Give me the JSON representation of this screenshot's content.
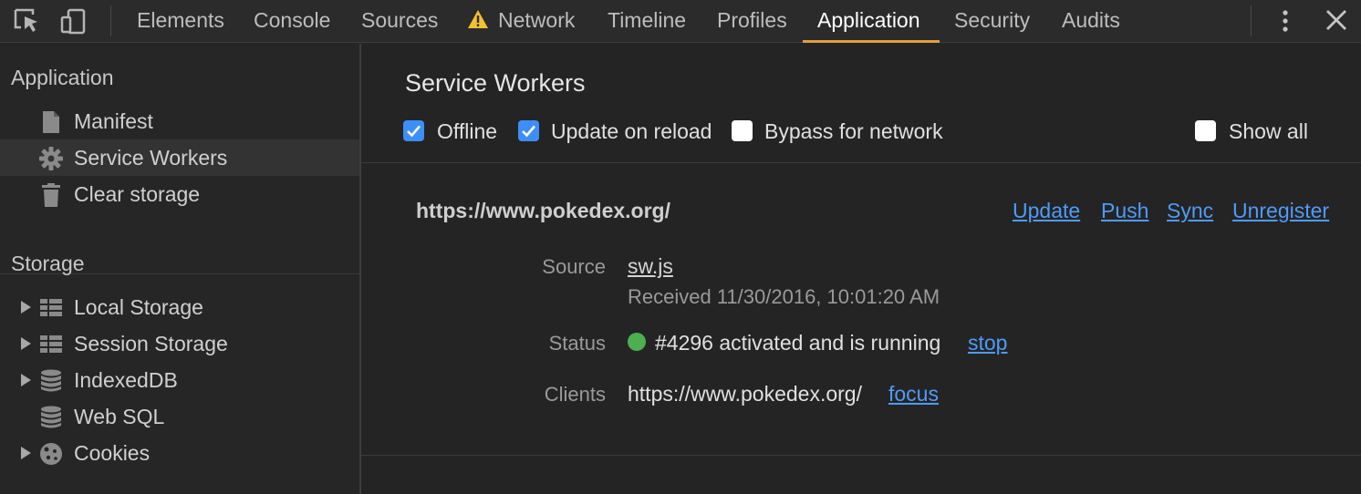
{
  "toolbar": {
    "tabs": [
      {
        "label": "Elements"
      },
      {
        "label": "Console"
      },
      {
        "label": "Sources"
      },
      {
        "label": "Network"
      },
      {
        "label": "Timeline"
      },
      {
        "label": "Profiles"
      },
      {
        "label": "Application"
      },
      {
        "label": "Security"
      },
      {
        "label": "Audits"
      }
    ],
    "active_tab": "Application",
    "accent_color": "#e0a040",
    "icons": [
      "inspect-element-icon",
      "device-toolbar-icon",
      "warning-icon",
      "more-menu-icon",
      "close-icon"
    ]
  },
  "sidebar": {
    "application_title": "Application",
    "application_items": [
      {
        "label": "Manifest",
        "icon": "document-icon"
      },
      {
        "label": "Service Workers",
        "icon": "gear-icon"
      },
      {
        "label": "Clear storage",
        "icon": "trash-icon"
      }
    ],
    "selected_item": "Service Workers",
    "storage_title": "Storage",
    "storage_items": [
      {
        "label": "Local Storage",
        "icon": "grid-icon"
      },
      {
        "label": "Session Storage",
        "icon": "grid-icon"
      },
      {
        "label": "IndexedDB",
        "icon": "database-icon"
      },
      {
        "label": "Web SQL",
        "icon": "database-icon"
      },
      {
        "label": "Cookies",
        "icon": "cookie-icon"
      }
    ]
  },
  "main": {
    "title": "Service Workers",
    "options": [
      {
        "label": "Offline",
        "checked": true
      },
      {
        "label": "Update on reload",
        "checked": true
      },
      {
        "label": "Bypass for network",
        "checked": false
      },
      {
        "label": "Show all",
        "checked": false
      }
    ],
    "worker": {
      "scope_url": "https://www.pokedex.org/",
      "actions": [
        "Update",
        "Push",
        "Sync",
        "Unregister"
      ],
      "source_label": "Source",
      "source_file": "sw.js",
      "received": "Received 11/30/2016, 10:01:20 AM",
      "status_label": "Status",
      "status_text": "#4296 activated and is running",
      "status_color": "#4caf50",
      "stop_label": "stop",
      "clients_label": "Clients",
      "client_url": "https://www.pokedex.org/",
      "focus_label": "focus"
    },
    "checkbox_color": "#3e8ef7",
    "link_color": "#4f9bf7"
  }
}
